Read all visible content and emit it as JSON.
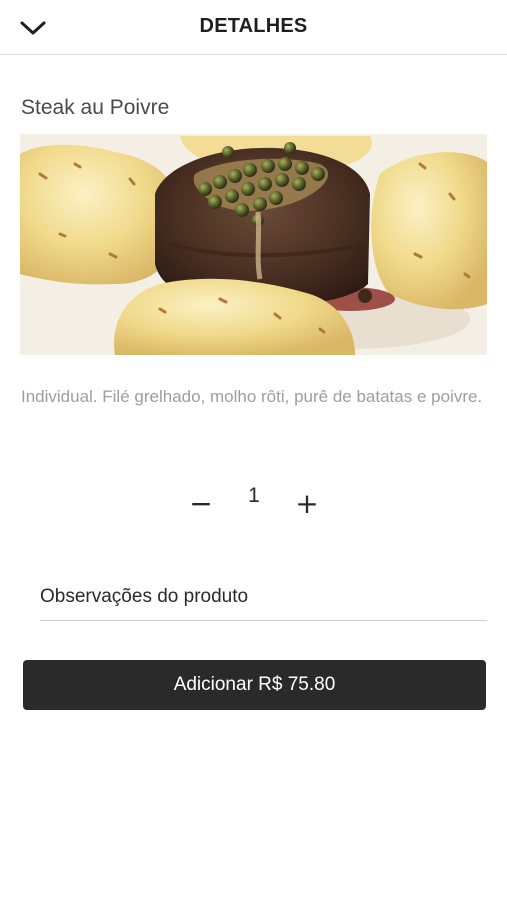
{
  "header": {
    "title": "DETALHES",
    "back_icon": "chevron-down-icon"
  },
  "product": {
    "name": "Steak au Poivre",
    "image_alt": "steak-with-peppercorn-sauce-and-potatoes",
    "description": "Individual. Filé grelhado, molho rôti, purê de batatas e poivre."
  },
  "quantity": {
    "minus_label": "−",
    "value": "1",
    "plus_label": "+"
  },
  "notes": {
    "placeholder": "Observações do produto",
    "value": ""
  },
  "add_button": {
    "label": "Adicionar R$ 75.80"
  },
  "colors": {
    "button_bg": "#2a2a2a",
    "description_text": "#9e9e9e",
    "divider": "#dcdcdc"
  }
}
